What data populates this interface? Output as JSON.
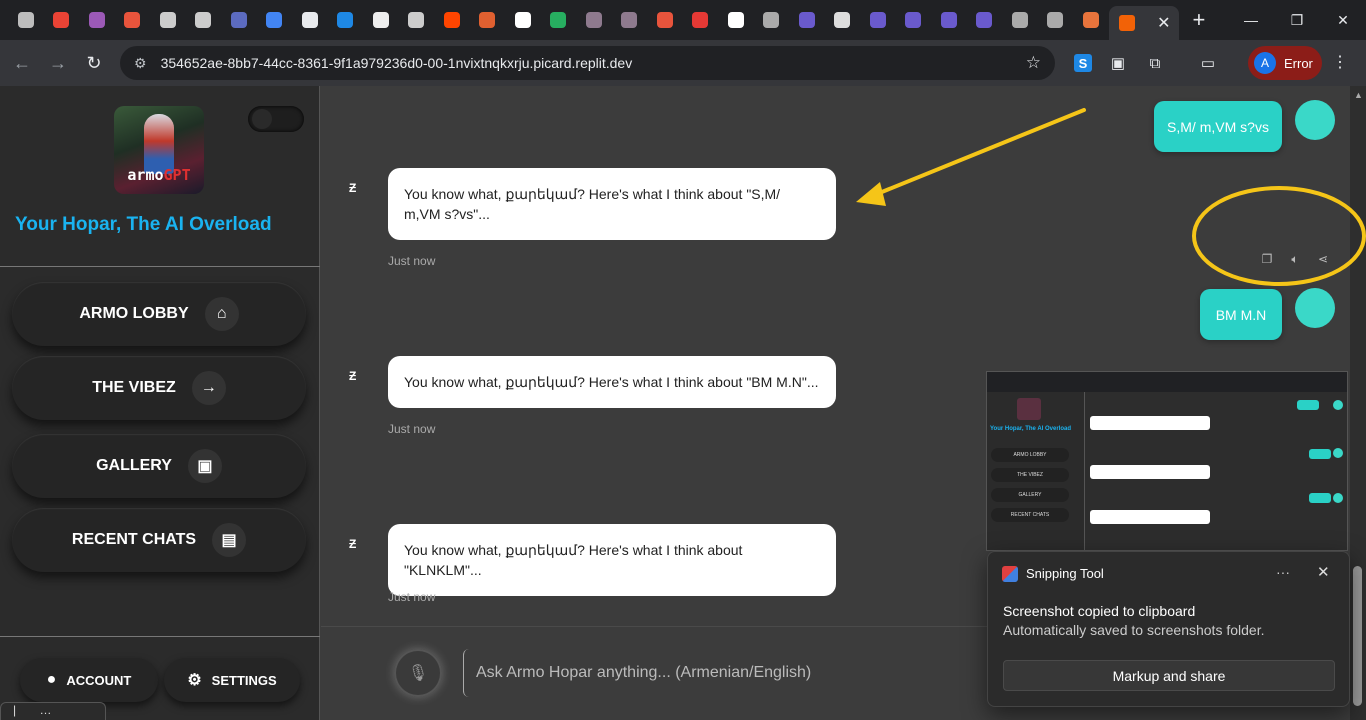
{
  "browser": {
    "tab_favicons": [
      "#bdbdbd",
      "#ea4335",
      "#9b59b6",
      "#e8543c",
      "#cccccc",
      "#cccccc",
      "#5c6bc0",
      "#4285f4",
      "#e8eaed",
      "#1e88e5",
      "#eeeeee",
      "#cccccc",
      "#ff4500",
      "#e06030",
      "#ffffff",
      "#27ae60",
      "#8e7a8e",
      "#8e7a8e",
      "#e8543c",
      "#e53935",
      "#ffffff",
      "#aaaaaa",
      "#6a5acd",
      "#dddddd",
      "#6a5acd",
      "#6a5acd",
      "#6a5acd",
      "#6a5acd",
      "#aaaaaa",
      "#aaaaaa",
      "#e8743c"
    ],
    "url": "354652ae-8bb7-44cc-8361-9f1a979236d0-00-1nvixtnqkxrju.picard.replit.dev",
    "profile_initial": "A",
    "profile_status": "Error"
  },
  "sidebar": {
    "logo_text_a": "armo",
    "logo_text_b": "GPT",
    "tagline": "Your Hopar, The AI Overload",
    "nav": [
      {
        "label": "ARMO LOBBY",
        "icon": "home-icon"
      },
      {
        "label": "THE VIBEZ",
        "icon": "arrow-right-icon"
      },
      {
        "label": "GALLERY",
        "icon": "image-icon"
      },
      {
        "label": "RECENT CHATS",
        "icon": "chat-icon"
      }
    ],
    "account_label": "ACCOUNT",
    "settings_label": "SETTINGS"
  },
  "chat": {
    "messages": [
      {
        "role": "user",
        "text": "S,M/ m,VM s?vs"
      },
      {
        "role": "ai",
        "text": "You know what, քարեկամ? Here's what I think about \"S,M/ m,VM s?vs\"...",
        "time": "Just now"
      },
      {
        "role": "user",
        "text": "BM M.N"
      },
      {
        "role": "ai",
        "text": "You know what, քարեկամ? Here's what I think about \"BM M.N\"...",
        "time": "Just now"
      },
      {
        "role": "ai",
        "text": "You know what, քարեկամ? Here's what I think about \"KLNKLM\"...",
        "time": "Just now"
      }
    ],
    "input_placeholder": "Ask Armo Hopar anything... (Armenian/English)"
  },
  "thumbnail": {
    "tagline": "Your Hopar, The AI Overload",
    "nav": [
      "ARMO LOBBY",
      "THE VIBEZ",
      "GALLERY",
      "RECENT CHATS"
    ]
  },
  "toast": {
    "app_name": "Snipping Tool",
    "title": "Screenshot copied to clipboard",
    "body": "Automatically saved to screenshots folder.",
    "action": "Markup and share"
  },
  "colors": {
    "accent_teal": "#2ad1c6",
    "tagline_blue": "#1ab3f0",
    "annotation_yellow": "#f5c518",
    "error_red": "#8c1d18"
  }
}
